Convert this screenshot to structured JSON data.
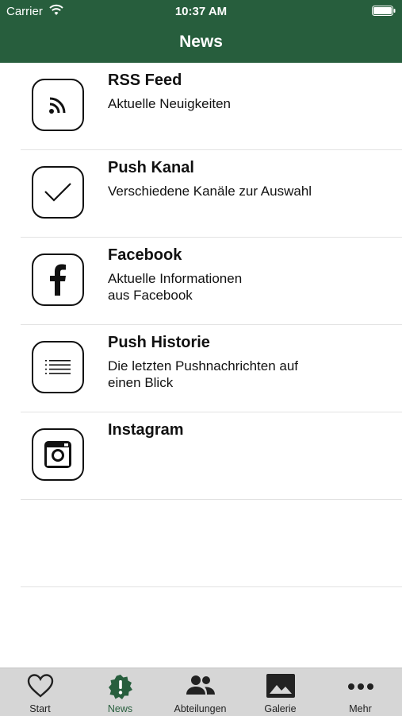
{
  "status_bar": {
    "carrier": "Carrier",
    "time": "10:37 AM"
  },
  "header": {
    "title": "News"
  },
  "colors": {
    "header_bg": "#275e3d",
    "tab_active": "#275e3d",
    "tabbar_bg": "#d6d6d6"
  },
  "items": [
    {
      "title": "RSS Feed",
      "subtitle": "Aktuelle Neuigkeiten",
      "icon": "rss-icon"
    },
    {
      "title": "Push Kanal",
      "subtitle": "Verschiedene Kanäle zur Auswahl",
      "icon": "checkmark-icon"
    },
    {
      "title": "Facebook",
      "subtitle": "Aktuelle Informationen\naus Facebook",
      "icon": "facebook-icon"
    },
    {
      "title": "Push Historie",
      "subtitle": "Die letzten Pushnachrichten auf\neinen Blick",
      "icon": "list-icon"
    },
    {
      "title": "Instagram",
      "subtitle": "",
      "icon": "instagram-icon"
    }
  ],
  "tabs": [
    {
      "label": "Start",
      "icon": "heart-icon",
      "active": false
    },
    {
      "label": "News",
      "icon": "alert-badge-icon",
      "active": true
    },
    {
      "label": "Abteilungen",
      "icon": "people-icon",
      "active": false
    },
    {
      "label": "Galerie",
      "icon": "image-icon",
      "active": false
    },
    {
      "label": "Mehr",
      "icon": "more-icon",
      "active": false
    }
  ]
}
